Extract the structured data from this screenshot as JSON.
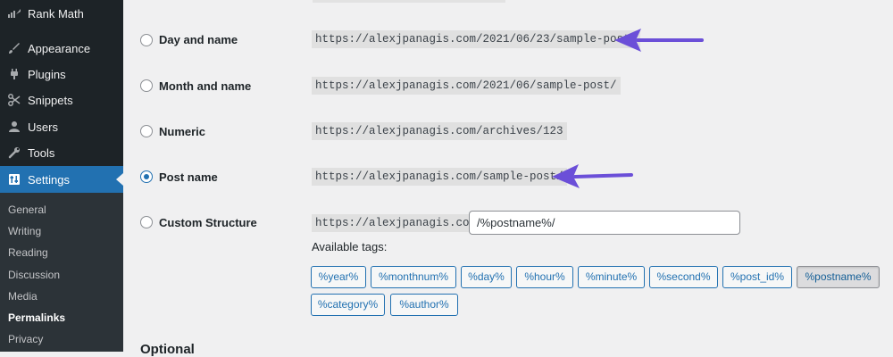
{
  "sidebar": {
    "top_item": {
      "label": "Rank Math",
      "icon": "rank-math-icon"
    },
    "items": [
      {
        "label": "Appearance",
        "icon": "paintbrush-icon"
      },
      {
        "label": "Plugins",
        "icon": "plug-icon"
      },
      {
        "label": "Snippets",
        "icon": "scissors-icon"
      },
      {
        "label": "Users",
        "icon": "user-icon"
      },
      {
        "label": "Tools",
        "icon": "wrench-icon"
      },
      {
        "label": "Settings",
        "icon": "settings-icon",
        "active": true
      }
    ],
    "submenu": [
      {
        "label": "General"
      },
      {
        "label": "Writing"
      },
      {
        "label": "Reading"
      },
      {
        "label": "Discussion"
      },
      {
        "label": "Media"
      },
      {
        "label": "Permalinks",
        "current": true
      },
      {
        "label": "Privacy"
      }
    ]
  },
  "permalink_options": [
    {
      "label": "Day and name",
      "example": "https://alexjpanagis.com/2021/06/23/sample-post/",
      "checked": false,
      "annotated": true
    },
    {
      "label": "Month and name",
      "example": "https://alexjpanagis.com/2021/06/sample-post/",
      "checked": false
    },
    {
      "label": "Numeric",
      "example": "https://alexjpanagis.com/archives/123",
      "checked": false
    },
    {
      "label": "Post name",
      "example": "https://alexjpanagis.com/sample-post/",
      "checked": true,
      "annotated": true
    },
    {
      "label": "Custom Structure",
      "prefix": "https://alexjpanagis.com",
      "value": "/%postname%/",
      "checked": false
    }
  ],
  "available_tags_label": "Available tags:",
  "tags": [
    "%year%",
    "%monthnum%",
    "%day%",
    "%hour%",
    "%minute%",
    "%second%",
    "%post_id%",
    "%postname%",
    "%category%",
    "%author%"
  ],
  "active_tag": "%postname%",
  "optional_heading": "Optional",
  "colors": {
    "sidebar_bg": "#1d2327",
    "accent": "#2271b1",
    "annotation_arrow": "#6b4fd8"
  }
}
